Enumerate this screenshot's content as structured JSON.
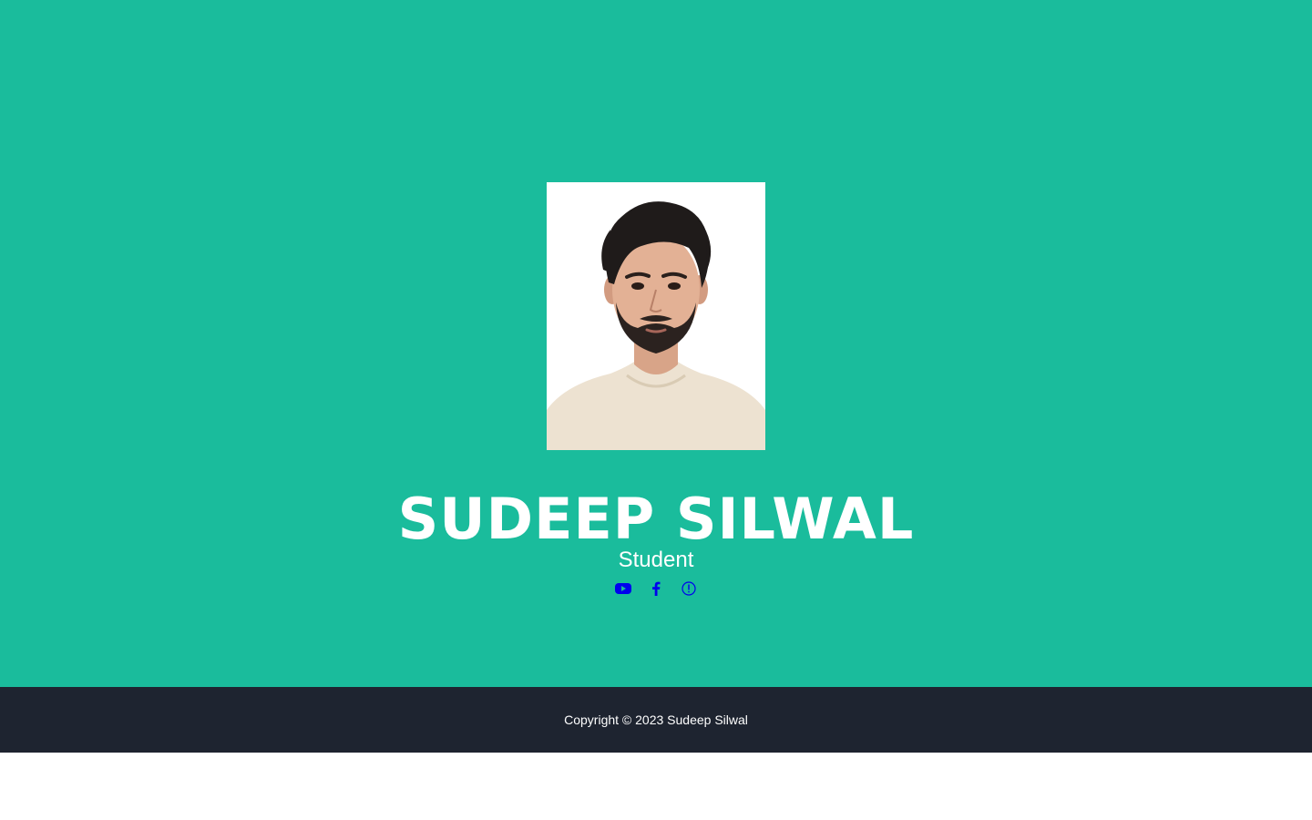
{
  "profile": {
    "name": "SUDEEP SILWAL",
    "role": "Student"
  },
  "socials": [
    {
      "icon": "youtube-icon"
    },
    {
      "icon": "facebook-icon"
    },
    {
      "icon": "info-icon"
    }
  ],
  "footer": {
    "copyright": "Copyright © 2023 Sudeep Silwal"
  },
  "colors": {
    "hero_background": "#1abc9c",
    "footer_background": "#1e2430",
    "text": "#ffffff",
    "icon": "#0000ee"
  }
}
